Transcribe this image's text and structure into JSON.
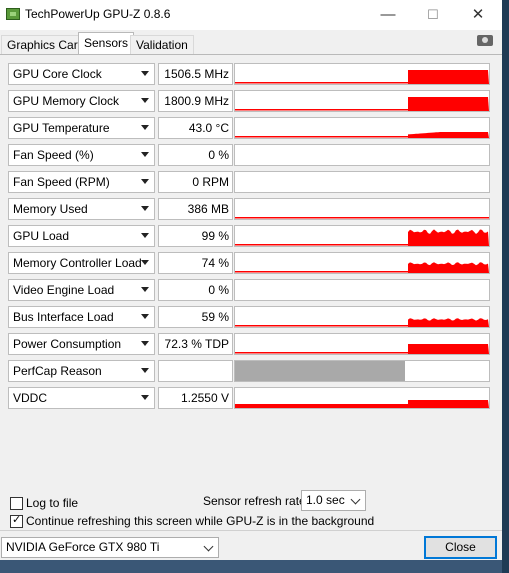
{
  "window": {
    "title": "TechPowerUp GPU-Z 0.8.6"
  },
  "titlebar": {
    "minimize": "—",
    "maximize": "☐",
    "close": "✕"
  },
  "tabs": [
    {
      "label": "Graphics Card",
      "active": false
    },
    {
      "label": "Sensors",
      "active": true
    },
    {
      "label": "Validation",
      "active": false
    }
  ],
  "toolbar": {
    "screenshot_icon": "camera-icon"
  },
  "sensors": [
    {
      "name": "GPU Core Clock",
      "value": "1506.5 MHz"
    },
    {
      "name": "GPU Memory Clock",
      "value": "1800.9 MHz"
    },
    {
      "name": "GPU Temperature",
      "value": "43.0 °C"
    },
    {
      "name": "Fan Speed (%)",
      "value": "0 %"
    },
    {
      "name": "Fan Speed (RPM)",
      "value": "0 RPM"
    },
    {
      "name": "Memory Used",
      "value": "386 MB"
    },
    {
      "name": "GPU Load",
      "value": "99 %"
    },
    {
      "name": "Memory Controller Load",
      "value": "74 %"
    },
    {
      "name": "Video Engine Load",
      "value": "0 %"
    },
    {
      "name": "Bus Interface Load",
      "value": "59 %"
    },
    {
      "name": "Power Consumption",
      "value": "72.3 % TDP"
    },
    {
      "name": "PerfCap Reason",
      "value": ""
    },
    {
      "name": "VDDC",
      "value": "1.2550 V"
    }
  ],
  "options": {
    "log_to_file": {
      "label": "Log to file",
      "checked": false
    },
    "continue_refresh": {
      "label": "Continue refreshing this screen while GPU-Z is in the background",
      "checked": true
    },
    "refresh_rate_label": "Sensor refresh rate:",
    "refresh_rate_value": "1.0 sec"
  },
  "footer": {
    "gpu_select": "NVIDIA GeForce GTX 980 Ti",
    "close_label": "Close"
  },
  "colors": {
    "graph": "#ff0000",
    "perfcap": "#a9a9a9",
    "accent": "#0078d7"
  }
}
